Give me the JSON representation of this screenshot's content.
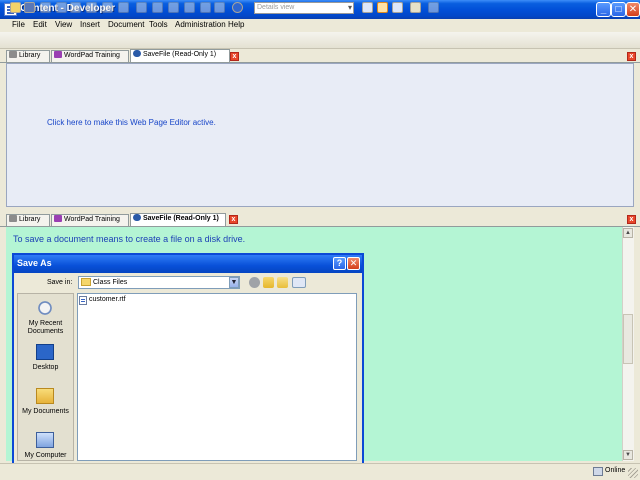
{
  "window": {
    "title": "Content - Developer"
  },
  "menu": [
    "File",
    "Edit",
    "View",
    "Insert",
    "Document",
    "Tools",
    "Administration",
    "Help"
  ],
  "toolbar": {
    "view_select": "Details view"
  },
  "top_tabs": [
    {
      "label": "Library"
    },
    {
      "label": "WordPad Training"
    },
    {
      "label": "SaveFile (Read-Only 1)"
    }
  ],
  "top_panel": {
    "link_text": "Click here to make this Web Page Editor active."
  },
  "bottom_tabs": [
    {
      "label": "Library"
    },
    {
      "label": "WordPad Training"
    },
    {
      "label": "SaveFile (Read-Only 1)"
    }
  ],
  "bottom_panel": {
    "intro": "To save a document means to create a file on a disk drive."
  },
  "save_dialog": {
    "title": "Save As",
    "help_glyph": "?",
    "close_glyph": "✕",
    "save_in_label": "Save in:",
    "save_in_value": "Class Files",
    "places": [
      "My Recent Documents",
      "Desktop",
      "My Documents",
      "My Computer"
    ],
    "files": [
      "customer.rtf"
    ]
  },
  "status": {
    "online": "Online"
  },
  "colors": {
    "accent": "#0250d8",
    "bottom_bg": "#b4f5d4",
    "top_bg": "#e8ecf6",
    "link": "#1846c8"
  }
}
